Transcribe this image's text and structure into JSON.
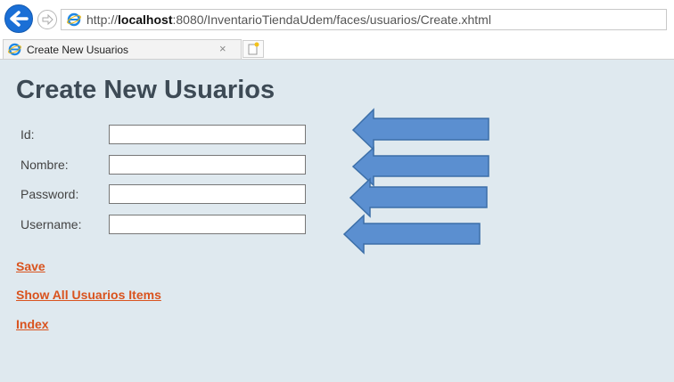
{
  "browser": {
    "url_prefix": "http://",
    "url_host": "localhost",
    "url_rest": ":8080/InventarioTiendaUdem/faces/usuarios/Create.xhtml",
    "tab_title": "Create New Usuarios",
    "tab_close_icon": "×",
    "accent": "#1a6fd6"
  },
  "page": {
    "title": "Create New Usuarios",
    "background": "#dfe9ef"
  },
  "form": {
    "fields": [
      {
        "label": "Id:",
        "value": ""
      },
      {
        "label": "Nombre:",
        "value": ""
      },
      {
        "label": "Password:",
        "value": ""
      },
      {
        "label": "Username:",
        "value": ""
      }
    ]
  },
  "links": {
    "save": "Save",
    "show_all": "Show All Usuarios Items",
    "index": "Index",
    "color": "#d9531e"
  },
  "annotations": {
    "arrow_color": "#5b8fd0",
    "arrow_icon": "left-arrow-icon"
  }
}
